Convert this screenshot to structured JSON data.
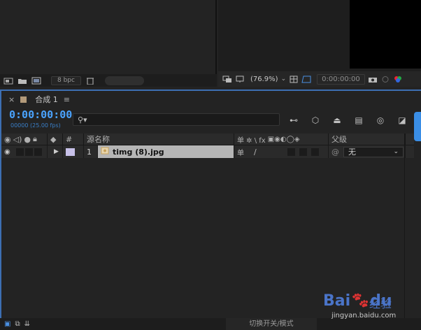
{
  "project_panel": {
    "bpc_label": "8 bpc",
    "footer_icons": [
      "interpret-footage-icon",
      "new-folder-icon",
      "new-comp-icon",
      "trash-icon"
    ]
  },
  "viewer": {
    "zoom": "(76.9%)",
    "timecode": "0:00:00:00"
  },
  "timeline": {
    "tab": {
      "close": "×",
      "title": "合成 1",
      "menu": "≡"
    },
    "timecode": "0:00:00:00",
    "frame_info": "00000 (25.00 fps)",
    "search_placeholder": "",
    "columns": {
      "num": "#",
      "source_name": "源名称",
      "switches": "单 ✲ \\ fx",
      "parent": "父级"
    },
    "layers": [
      {
        "number": "1",
        "name": "timg (8).jpg",
        "parent": "无"
      }
    ],
    "bottom_mode_label": "切换开关/模式"
  },
  "watermark": {
    "brand": "Bai",
    "brand2": "du",
    "jingyan": "经验",
    "url": "jingyan.baidu.com"
  },
  "colors": {
    "accent_blue": "#4aa3ff",
    "panel_border": "#3d6fb3",
    "label_lavender": "#c7c0e8"
  }
}
